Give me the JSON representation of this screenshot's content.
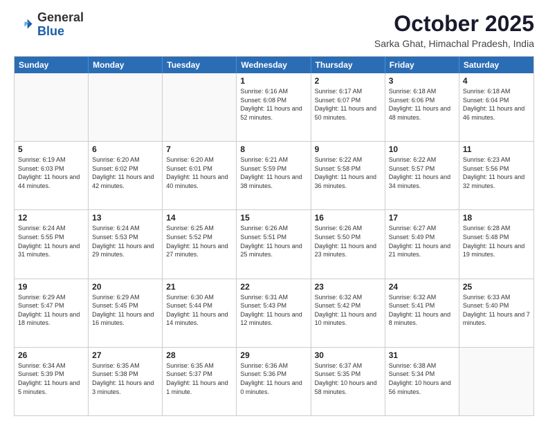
{
  "header": {
    "logo_general": "General",
    "logo_blue": "Blue",
    "month_title": "October 2025",
    "location": "Sarka Ghat, Himachal Pradesh, India"
  },
  "days_of_week": [
    "Sunday",
    "Monday",
    "Tuesday",
    "Wednesday",
    "Thursday",
    "Friday",
    "Saturday"
  ],
  "weeks": [
    [
      {
        "day": "",
        "empty": true
      },
      {
        "day": "",
        "empty": true
      },
      {
        "day": "",
        "empty": true
      },
      {
        "day": "1",
        "sunrise": "6:16 AM",
        "sunset": "6:08 PM",
        "daylight": "11 hours and 52 minutes."
      },
      {
        "day": "2",
        "sunrise": "6:17 AM",
        "sunset": "6:07 PM",
        "daylight": "11 hours and 50 minutes."
      },
      {
        "day": "3",
        "sunrise": "6:18 AM",
        "sunset": "6:06 PM",
        "daylight": "11 hours and 48 minutes."
      },
      {
        "day": "4",
        "sunrise": "6:18 AM",
        "sunset": "6:04 PM",
        "daylight": "11 hours and 46 minutes."
      }
    ],
    [
      {
        "day": "5",
        "sunrise": "6:19 AM",
        "sunset": "6:03 PM",
        "daylight": "11 hours and 44 minutes."
      },
      {
        "day": "6",
        "sunrise": "6:20 AM",
        "sunset": "6:02 PM",
        "daylight": "11 hours and 42 minutes."
      },
      {
        "day": "7",
        "sunrise": "6:20 AM",
        "sunset": "6:01 PM",
        "daylight": "11 hours and 40 minutes."
      },
      {
        "day": "8",
        "sunrise": "6:21 AM",
        "sunset": "5:59 PM",
        "daylight": "11 hours and 38 minutes."
      },
      {
        "day": "9",
        "sunrise": "6:22 AM",
        "sunset": "5:58 PM",
        "daylight": "11 hours and 36 minutes."
      },
      {
        "day": "10",
        "sunrise": "6:22 AM",
        "sunset": "5:57 PM",
        "daylight": "11 hours and 34 minutes."
      },
      {
        "day": "11",
        "sunrise": "6:23 AM",
        "sunset": "5:56 PM",
        "daylight": "11 hours and 32 minutes."
      }
    ],
    [
      {
        "day": "12",
        "sunrise": "6:24 AM",
        "sunset": "5:55 PM",
        "daylight": "11 hours and 31 minutes."
      },
      {
        "day": "13",
        "sunrise": "6:24 AM",
        "sunset": "5:53 PM",
        "daylight": "11 hours and 29 minutes."
      },
      {
        "day": "14",
        "sunrise": "6:25 AM",
        "sunset": "5:52 PM",
        "daylight": "11 hours and 27 minutes."
      },
      {
        "day": "15",
        "sunrise": "6:26 AM",
        "sunset": "5:51 PM",
        "daylight": "11 hours and 25 minutes."
      },
      {
        "day": "16",
        "sunrise": "6:26 AM",
        "sunset": "5:50 PM",
        "daylight": "11 hours and 23 minutes."
      },
      {
        "day": "17",
        "sunrise": "6:27 AM",
        "sunset": "5:49 PM",
        "daylight": "11 hours and 21 minutes."
      },
      {
        "day": "18",
        "sunrise": "6:28 AM",
        "sunset": "5:48 PM",
        "daylight": "11 hours and 19 minutes."
      }
    ],
    [
      {
        "day": "19",
        "sunrise": "6:29 AM",
        "sunset": "5:47 PM",
        "daylight": "11 hours and 18 minutes."
      },
      {
        "day": "20",
        "sunrise": "6:29 AM",
        "sunset": "5:45 PM",
        "daylight": "11 hours and 16 minutes."
      },
      {
        "day": "21",
        "sunrise": "6:30 AM",
        "sunset": "5:44 PM",
        "daylight": "11 hours and 14 minutes."
      },
      {
        "day": "22",
        "sunrise": "6:31 AM",
        "sunset": "5:43 PM",
        "daylight": "11 hours and 12 minutes."
      },
      {
        "day": "23",
        "sunrise": "6:32 AM",
        "sunset": "5:42 PM",
        "daylight": "11 hours and 10 minutes."
      },
      {
        "day": "24",
        "sunrise": "6:32 AM",
        "sunset": "5:41 PM",
        "daylight": "11 hours and 8 minutes."
      },
      {
        "day": "25",
        "sunrise": "6:33 AM",
        "sunset": "5:40 PM",
        "daylight": "11 hours and 7 minutes."
      }
    ],
    [
      {
        "day": "26",
        "sunrise": "6:34 AM",
        "sunset": "5:39 PM",
        "daylight": "11 hours and 5 minutes."
      },
      {
        "day": "27",
        "sunrise": "6:35 AM",
        "sunset": "5:38 PM",
        "daylight": "11 hours and 3 minutes."
      },
      {
        "day": "28",
        "sunrise": "6:35 AM",
        "sunset": "5:37 PM",
        "daylight": "11 hours and 1 minute."
      },
      {
        "day": "29",
        "sunrise": "6:36 AM",
        "sunset": "5:36 PM",
        "daylight": "11 hours and 0 minutes."
      },
      {
        "day": "30",
        "sunrise": "6:37 AM",
        "sunset": "5:35 PM",
        "daylight": "10 hours and 58 minutes."
      },
      {
        "day": "31",
        "sunrise": "6:38 AM",
        "sunset": "5:34 PM",
        "daylight": "10 hours and 56 minutes."
      },
      {
        "day": "",
        "empty": true
      }
    ]
  ]
}
